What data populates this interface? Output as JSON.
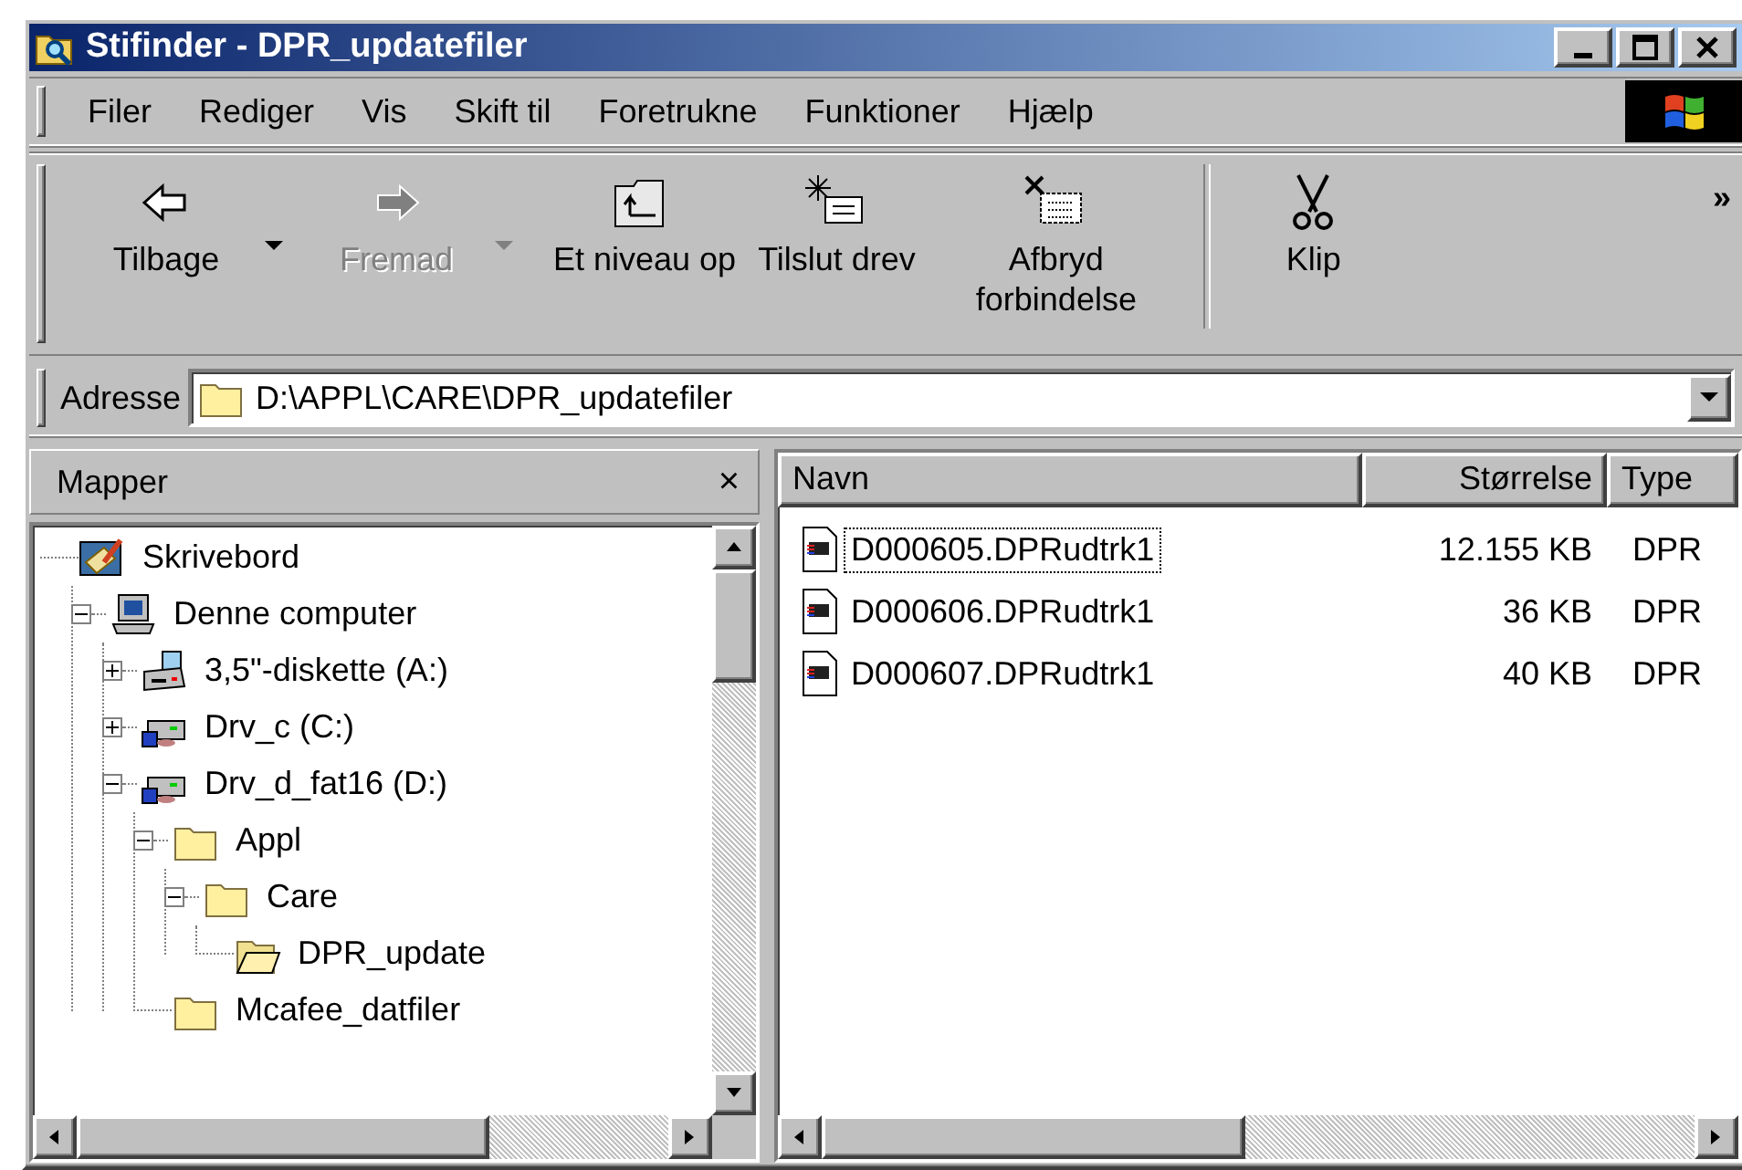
{
  "window": {
    "title": "Stifinder - DPR_updatefiler"
  },
  "menu": [
    "Filer",
    "Rediger",
    "Vis",
    "Skift til",
    "Foretrukne",
    "Funktioner",
    "Hjælp"
  ],
  "toolbar": {
    "groups": [
      {
        "buttons": [
          {
            "kind": "back",
            "label": "Tilbage",
            "dropdown": true,
            "disabled": false
          },
          {
            "kind": "forward",
            "label": "Fremad",
            "dropdown": true,
            "disabled": true
          },
          {
            "kind": "up-folder",
            "label": "Et niveau op",
            "dropdown": false,
            "disabled": false
          },
          {
            "kind": "map-drive",
            "label": "Tilslut drev",
            "dropdown": false,
            "disabled": false
          },
          {
            "kind": "disconnect",
            "label": "Afbryd forbindelse",
            "dropdown": false,
            "disabled": false
          }
        ]
      },
      {
        "buttons": [
          {
            "kind": "cut",
            "label": "Klip",
            "dropdown": false,
            "disabled": false
          }
        ]
      }
    ],
    "overflow": "»"
  },
  "address": {
    "label": "Adresse",
    "value": "D:\\APPL\\CARE\\DPR_updatefiler"
  },
  "folders_pane": {
    "title": "Mapper",
    "close": "×",
    "tree": [
      {
        "kind": "desktop",
        "label": "Skrivebord",
        "children": [
          {
            "kind": "computer",
            "label": "Denne computer",
            "expanded": true,
            "children": [
              {
                "kind": "floppy",
                "label": "3,5\"-diskette (A:)",
                "expanded": false
              },
              {
                "kind": "drive",
                "label": "Drv_c (C:)",
                "expanded": false
              },
              {
                "kind": "drive",
                "label": "Drv_d_fat16 (D:)",
                "expanded": true,
                "children": [
                  {
                    "kind": "folder",
                    "label": "Appl",
                    "expanded": true,
                    "children": [
                      {
                        "kind": "folder",
                        "label": "Care",
                        "expanded": true,
                        "children": [
                          {
                            "kind": "open-folder",
                            "label": "DPR_update"
                          }
                        ]
                      }
                    ]
                  },
                  {
                    "kind": "folder",
                    "label": "Mcafee_datfiler"
                  }
                ]
              }
            ]
          }
        ]
      }
    ]
  },
  "file_list": {
    "columns": [
      "Navn",
      "Størrelse",
      "Type"
    ],
    "rows": [
      {
        "name": "D000605.DPRudtrk1",
        "size": "12.155 KB",
        "type": "DPR",
        "selected": true
      },
      {
        "name": "D000606.DPRudtrk1",
        "size": "36 KB",
        "type": "DPR",
        "selected": false
      },
      {
        "name": "D000607.DPRudtrk1",
        "size": "40 KB",
        "type": "DPR",
        "selected": false
      }
    ]
  }
}
